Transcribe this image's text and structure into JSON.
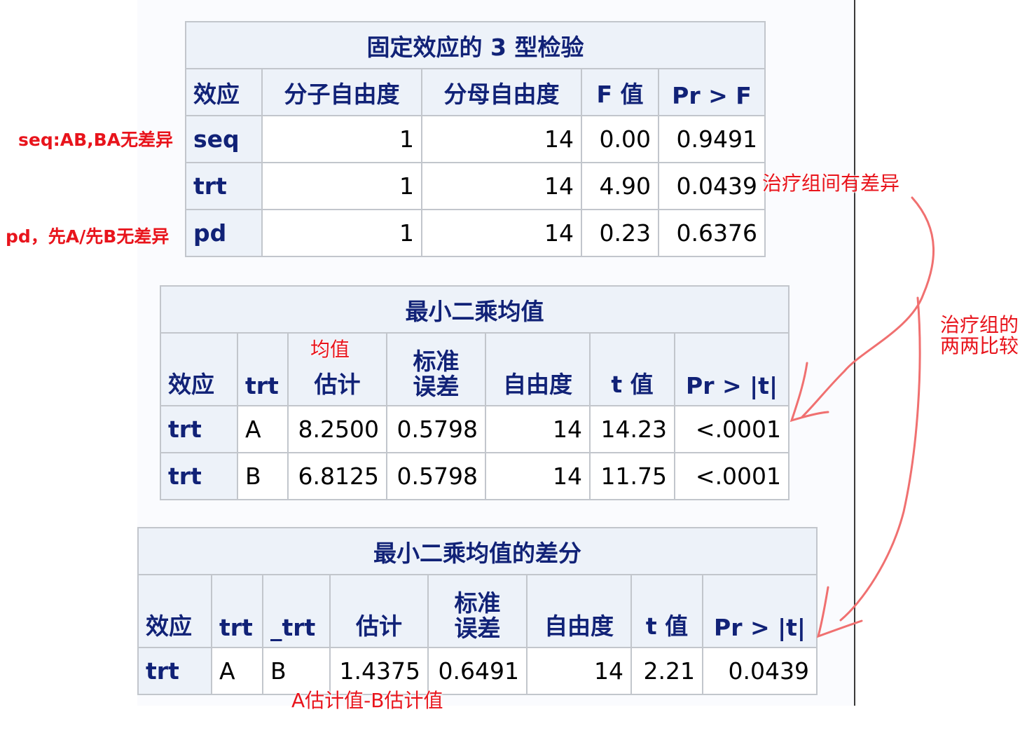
{
  "type3": {
    "title": "固定效应的 3 型检验",
    "headers": [
      "效应",
      "分子自由度",
      "分母自由度",
      "F 值",
      "Pr > F"
    ],
    "rows": [
      {
        "effect": "seq",
        "num_df": "1",
        "den_df": "14",
        "f": "0.00",
        "p": "0.9491"
      },
      {
        "effect": "trt",
        "num_df": "1",
        "den_df": "14",
        "f": "4.90",
        "p": "0.0439"
      },
      {
        "effect": "pd",
        "num_df": "1",
        "den_df": "14",
        "f": "0.23",
        "p": "0.6376"
      }
    ]
  },
  "lsmeans": {
    "title": "最小二乘均值",
    "headers": {
      "effect": "效应",
      "trt": "trt",
      "estimate": "估计",
      "se_line1": "标准",
      "se_line2": "误差",
      "df": "自由度",
      "t": "t 值",
      "p": "Pr > |t|"
    },
    "rows": [
      {
        "effect": "trt",
        "trt": "A",
        "estimate": "8.2500",
        "se": "0.5798",
        "df": "14",
        "t": "14.23",
        "p": "<.0001"
      },
      {
        "effect": "trt",
        "trt": "B",
        "estimate": "6.8125",
        "se": "0.5798",
        "df": "14",
        "t": "11.75",
        "p": "<.0001"
      }
    ]
  },
  "diffs": {
    "title": "最小二乘均值的差分",
    "headers": {
      "effect": "效应",
      "trt": "trt",
      "trt2": "_trt",
      "estimate": "估计",
      "se_line1": "标准",
      "se_line2": "误差",
      "df": "自由度",
      "t": "t 值",
      "p": "Pr > |t|"
    },
    "rows": [
      {
        "effect": "trt",
        "trt": "A",
        "trt2": "B",
        "estimate": "1.4375",
        "se": "0.6491",
        "df": "14",
        "t": "2.21",
        "p": "0.0439"
      }
    ]
  },
  "annotations": {
    "seq_note": "seq:AB,BA无差异",
    "pd_note": "pd，先A/先B无差异",
    "trt_note": "治疗组间有差异",
    "mean_note": "均值",
    "pairwise_line1": "治疗组的",
    "pairwise_line2": "两两比较",
    "diff_note": "A估计值-B估计值"
  },
  "colors": {
    "header_bg": "#edf2f9",
    "header_text": "#112277",
    "border": "#c2c6cc",
    "annotation": "#e8141c",
    "arrow": "#f07070"
  }
}
